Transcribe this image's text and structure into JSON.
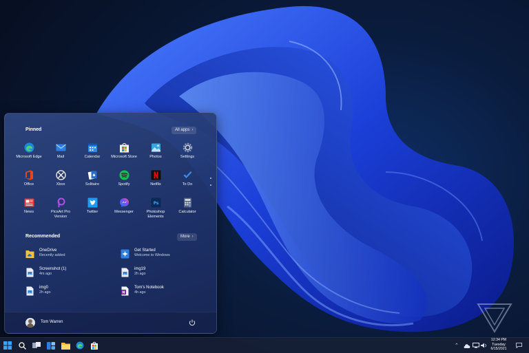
{
  "start_menu": {
    "pinned_title": "Pinned",
    "all_apps_label": "All apps",
    "pinned_apps": [
      {
        "label": "Microsoft Edge",
        "icon": "edge-icon",
        "color": "#1e88d8"
      },
      {
        "label": "Mail",
        "icon": "mail-icon",
        "color": "#2b7fe0"
      },
      {
        "label": "Calendar",
        "icon": "calendar-icon",
        "color": "#2d8ae6"
      },
      {
        "label": "Microsoft Store",
        "icon": "store-icon",
        "color": "#f3f3f3"
      },
      {
        "label": "Photos",
        "icon": "photos-icon",
        "color": "#3aa6e0"
      },
      {
        "label": "Settings",
        "icon": "gear-icon",
        "color": "#8a9bb4"
      },
      {
        "label": "Office",
        "icon": "office-icon",
        "color": "#e8441f"
      },
      {
        "label": "Xbox",
        "icon": "xbox-icon",
        "color": "#ffffff"
      },
      {
        "label": "Solitaire",
        "icon": "solitaire-icon",
        "color": "#2a6fc9"
      },
      {
        "label": "Spotify",
        "icon": "spotify-icon",
        "color": "#1db954"
      },
      {
        "label": "Netflix",
        "icon": "netflix-icon",
        "color": "#111111"
      },
      {
        "label": "To Do",
        "icon": "todo-icon",
        "color": "#3c8be8"
      },
      {
        "label": "News",
        "icon": "news-icon",
        "color": "#e23a3a"
      },
      {
        "label": "PicsArt Pro\nVersion",
        "icon": "picsart-icon",
        "color": "#b34fe0"
      },
      {
        "label": "Twitter",
        "icon": "twitter-icon",
        "color": "#1d9bf0"
      },
      {
        "label": "Messenger",
        "icon": "messenger-icon",
        "color": "#7a4cf0"
      },
      {
        "label": "Photoshop\nElements",
        "icon": "photoshop-icon",
        "color": "#0a2a55"
      },
      {
        "label": "Calculator",
        "icon": "calculator-icon",
        "color": "#566379"
      }
    ],
    "recommended_title": "Recommended",
    "more_label": "More",
    "recommended": [
      {
        "title": "OneDrive",
        "subtitle": "Recently added",
        "icon": "onedrive-folder-icon",
        "color": "#f0c040"
      },
      {
        "title": "Get Started",
        "subtitle": "Welcome to Windows",
        "icon": "get-started-icon",
        "color": "#2e7fe0"
      },
      {
        "title": "Screenshot (1)",
        "subtitle": "4m ago",
        "icon": "image-file-icon",
        "color": "#e8eef8"
      },
      {
        "title": "img19",
        "subtitle": "2h ago",
        "icon": "image-file-icon",
        "color": "#e8eef8"
      },
      {
        "title": "img0",
        "subtitle": "2h ago",
        "icon": "image-file-icon",
        "color": "#e8eef8"
      },
      {
        "title": "Tom's Notebook",
        "subtitle": "4h ago",
        "icon": "onenote-icon",
        "color": "#f2f2f2"
      }
    ],
    "user_name": "Tom Warren"
  },
  "taskbar": {
    "clock_time": "12:34 PM",
    "clock_day": "Tuesday",
    "clock_date": "6/15/2021"
  }
}
